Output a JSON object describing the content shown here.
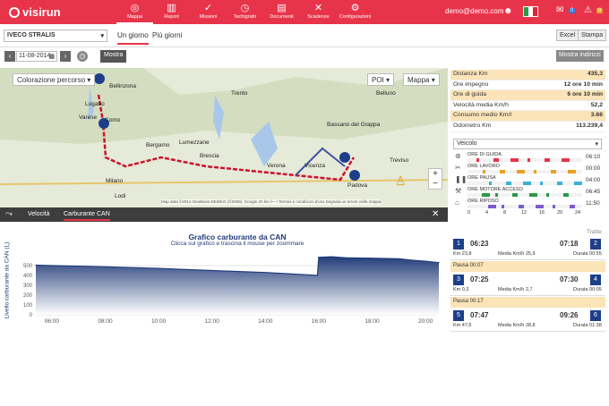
{
  "header": {
    "app_name": "visirun",
    "nav": [
      {
        "label": "Mappa",
        "icon": "target-icon",
        "glyph": "◎"
      },
      {
        "label": "Report",
        "icon": "bar-chart-icon",
        "glyph": "▥"
      },
      {
        "label": "Missioni",
        "icon": "check-icon",
        "glyph": "✓"
      },
      {
        "label": "Tachigrafo",
        "icon": "tachograph-icon",
        "glyph": "◷"
      },
      {
        "label": "Documenti",
        "icon": "document-icon",
        "glyph": "▤"
      },
      {
        "label": "Scadenze",
        "icon": "deadline-icon",
        "glyph": "✕"
      },
      {
        "label": "Configurazioni",
        "icon": "settings-icon",
        "glyph": "⚙"
      }
    ],
    "user_email": "demo@demo.com",
    "messages_count": "0",
    "alerts_count": "0"
  },
  "subbar": {
    "vehicle": "IVECO STRALIS",
    "tab_day": "Un giorno",
    "tab_days": "Più giorni",
    "excel": "Excel",
    "print": "Stampa"
  },
  "datebar": {
    "date": "11-08-2014",
    "show": "Mostra",
    "show_addresses": "Mostra indirizzi"
  },
  "map": {
    "color_select": "Colorazione percorso",
    "poi": "POI",
    "type_select": "Mappa",
    "credits": "Map data ©2014 GeoBasis-DE/BKG (©2009), Google   20 km ⊢⊣   Termini e condizioni d'uso   Segnala un errore nella mappa",
    "cities": [
      {
        "name": "Bellinzona"
      },
      {
        "name": "Lugano"
      },
      {
        "name": "Varese"
      },
      {
        "name": "Como"
      },
      {
        "name": "Bergamo"
      },
      {
        "name": "Brescia"
      },
      {
        "name": "Milano"
      },
      {
        "name": "Verona"
      },
      {
        "name": "Vicenza"
      },
      {
        "name": "Padova"
      },
      {
        "name": "Lodi"
      },
      {
        "name": "Lumezzane"
      },
      {
        "name": "Bassano del Grappa"
      },
      {
        "name": "Treviso"
      },
      {
        "name": "Belluno"
      },
      {
        "name": "Trento"
      }
    ]
  },
  "chart_panel": {
    "tab_speed": "Velocità",
    "tab_fuel": "Carburante CAN",
    "close": "✕"
  },
  "chart_data": {
    "type": "area",
    "title": "Grafico carburante da CAN",
    "subtitle": "Clicca sul grafico e trascina il mouse per zoommare",
    "xlabel": "",
    "ylabel": "Livello carburante da CAN (L)",
    "x_ticks": [
      "06:00",
      "08:00",
      "10:00",
      "12:00",
      "14:00",
      "16:00",
      "18:00",
      "20:00"
    ],
    "y_ticks": [
      0,
      100,
      200,
      300,
      400,
      500
    ],
    "ylim": [
      0,
      600
    ],
    "xlim": [
      5.4,
      20.5
    ],
    "x": [
      5.4,
      6.0,
      7.0,
      8.0,
      9.0,
      10.0,
      11.0,
      12.0,
      13.0,
      14.0,
      15.0,
      15.95,
      16.0,
      16.5,
      17.0,
      18.0,
      19.0,
      19.5,
      20.0,
      20.5
    ],
    "values": [
      505,
      500,
      495,
      488,
      480,
      472,
      460,
      450,
      440,
      430,
      415,
      400,
      585,
      590,
      580,
      575,
      570,
      555,
      545,
      530
    ],
    "color": "#233d7a"
  },
  "side": {
    "stats": [
      {
        "label": "Distanza Km",
        "value": "435,3",
        "hl": true
      },
      {
        "label": "Ore impegno",
        "value": "12 ore 10 min",
        "hl": false
      },
      {
        "label": "Ore di guida",
        "value": "6 ore 10 min",
        "hl": true
      },
      {
        "label": "Velocità media Km/h",
        "value": "52,2",
        "hl": false
      },
      {
        "label": "Consumo medio Km/l",
        "value": "3.66",
        "hl": true
      },
      {
        "label": "Odometro Km",
        "value": "113.239,4",
        "hl": false
      }
    ],
    "vehicle_select": "Veicolo",
    "timeline": [
      {
        "label": "ORE DI GUIDA",
        "time": "06:10",
        "icon": "steering-wheel-icon",
        "glyph": "⊛"
      },
      {
        "label": "ORE LAVORO",
        "time": "00:00",
        "icon": "tools-icon",
        "glyph": "✂"
      },
      {
        "label": "ORE PAUSA",
        "time": "04:00",
        "icon": "pause-icon",
        "glyph": "❚❚"
      },
      {
        "label": "ORE MOTORE ACCESO",
        "time": "06:45",
        "icon": "engine-icon",
        "glyph": "⚒"
      },
      {
        "label": "ORE RIPOSO",
        "time": "11:50",
        "icon": "bed-icon",
        "glyph": "⌂"
      }
    ],
    "timeline_ticks": [
      "0",
      "4",
      "8",
      "12",
      "16",
      "20",
      "24"
    ],
    "tratte_label": "Tratte",
    "trips": [
      {
        "n1": "1",
        "start": "06:23",
        "end": "07:18",
        "n2": "2",
        "km": "Km 23,8",
        "avg": "Media Km/h 25,9",
        "dur": "Durata 00:55"
      },
      {
        "n1": "3",
        "start": "07:25",
        "end": "07:30",
        "n2": "4",
        "km": "Km 0,3",
        "avg": "Media Km/h 2,7",
        "dur": "Durata 00:05"
      },
      {
        "n1": "5",
        "start": "07:47",
        "end": "09:26",
        "n2": "6",
        "km": "Km 47,6",
        "avg": "Media Km/h 28,8",
        "dur": "Durata 01:38"
      }
    ],
    "pauses": [
      "Pausa 00:07",
      "Pausa 00:17"
    ]
  }
}
